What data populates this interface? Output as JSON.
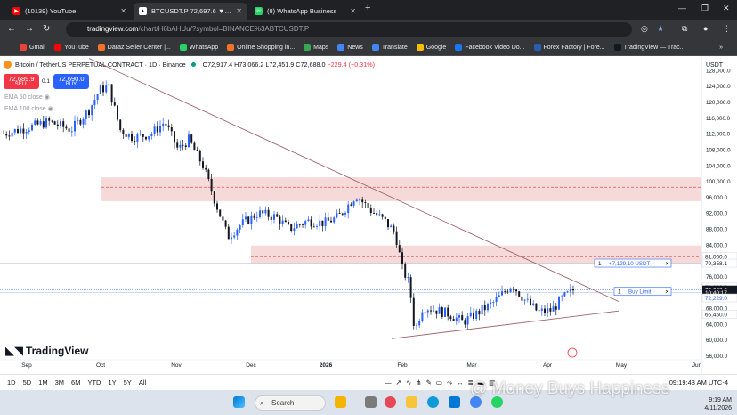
{
  "browser": {
    "tabs": [
      {
        "title": "(10139) YouTube",
        "icon": "youtube-icon",
        "color": "#ff0000",
        "active": false
      },
      {
        "title": "BTCUSDT.P 72,697.6 ▼ −0.3% S",
        "icon": "tradingview-icon",
        "color": "#131722",
        "active": true
      },
      {
        "title": "(8) WhatsApp Business",
        "icon": "whatsapp-icon",
        "color": "#25d366",
        "active": false
      }
    ],
    "new_tab": "+",
    "url_host": "tradingview.com",
    "url_path": "/chart/H6bAHUu/?symbol=BINANCE%3ABTCUSDT.P",
    "bookmarks": [
      {
        "label": "Gmail",
        "color": "#ea4335"
      },
      {
        "label": "YouTube",
        "color": "#ff0000"
      },
      {
        "label": "Daraz Seller Center |...",
        "color": "#f57224"
      },
      {
        "label": "WhatsApp",
        "color": "#25d366"
      },
      {
        "label": "Online Shopping in...",
        "color": "#f57224"
      },
      {
        "label": "Maps",
        "color": "#34a853"
      },
      {
        "label": "News",
        "color": "#4285f4"
      },
      {
        "label": "Translate",
        "color": "#4285f4"
      },
      {
        "label": "Google",
        "color": "#fbbc05"
      },
      {
        "label": "Facebook Video Do...",
        "color": "#1877f2"
      },
      {
        "label": "Forex Factory | Fore...",
        "color": "#2a5db0"
      },
      {
        "label": "TradingView — Trac...",
        "color": "#131722"
      }
    ]
  },
  "chart": {
    "symbol": "Bitcoin / TetherUS PERPETUAL CONTRACT · 1D · Binance",
    "ohlc": "O72,917.4 H73,066.2 L72,451.9 C72,688.0",
    "change": "−229.4 (−0.31%)",
    "sell_price": "72,689.9",
    "sell_label": "SELL",
    "spread": "0.1",
    "buy_price": "72,690.0",
    "buy_label": "BUY",
    "ema1": "EMA 50 close",
    "ema2": "EMA 100 close",
    "currency": "USDT",
    "logo": "TradingView",
    "order_qty": "1",
    "order_pnl": "+7,129.10 USDT",
    "limit_qty": "1",
    "limit_label": "Buy Limit",
    "price_ticks": [
      "128,000.0",
      "124,000.0",
      "120,000.0",
      "116,000.0",
      "112,000.0",
      "108,000.0",
      "104,000.0",
      "100,000.0",
      "96,000.0",
      "92,000.0",
      "88,000.0",
      "84,000.0",
      "80,000.0",
      "76,000.0",
      "72,000.0",
      "68,000.0",
      "64,000.0",
      "60,000.0",
      "56,000.0"
    ],
    "price_tick_values": [
      128000,
      124000,
      120000,
      116000,
      112000,
      108000,
      104000,
      100000,
      96000,
      92000,
      88000,
      84000,
      80000,
      76000,
      72000,
      68000,
      64000,
      60000,
      56000
    ],
    "price_labels": [
      {
        "text": "81,000.0",
        "value": 81000,
        "bg": "#ffffff",
        "fg": "#131722"
      },
      {
        "text": "79,358.1",
        "value": 79358.1,
        "bg": "#ffffff",
        "fg": "#131722"
      },
      {
        "text": "73,330.3",
        "value": 73330.3,
        "bg": "#ffffff",
        "fg": "#131722"
      },
      {
        "text": "72,688.0",
        "value": 72688,
        "bg": "#131722",
        "fg": "#ffffff"
      },
      {
        "text": "10:40:17",
        "value": 71900,
        "bg": "#131722",
        "fg": "#ffffff"
      },
      {
        "text": "72,229.0",
        "value": 70600,
        "bg": "#ffffff",
        "fg": "#2962ff"
      },
      {
        "text": "66,450.0",
        "value": 66450,
        "bg": "#ffffff",
        "fg": "#131722"
      }
    ],
    "time_labels": [
      "Sep",
      "Oct",
      "Nov",
      "Dec",
      "2026",
      "Feb",
      "Mar",
      "Apr",
      "May",
      "Jun"
    ],
    "timeframes": [
      "1D",
      "5D",
      "1M",
      "3M",
      "6M",
      "YTD",
      "1Y",
      "5Y",
      "All"
    ],
    "clock": "09:19:43 AM UTC-4",
    "resistance_zone": [
      95000,
      101000
    ],
    "resistance_level": 98500,
    "supply_zone": [
      79358.1,
      83800
    ],
    "supply_level": 81000,
    "current_price": 72688,
    "triangle": {
      "upper_start": 131000,
      "upper_end": 71500,
      "lower_start": 61000,
      "lower_end": 67300
    },
    "colors": {
      "up": "#2962ff",
      "down": "#131722",
      "zone": "#f6d9d9",
      "zone_line": "#e05252",
      "trend": "#a0646a"
    }
  },
  "taskbar": {
    "search_placeholder": "Search",
    "time": "9:19 AM",
    "date": "4/11/2026",
    "watermark": "@ Money Buys Happiness"
  }
}
